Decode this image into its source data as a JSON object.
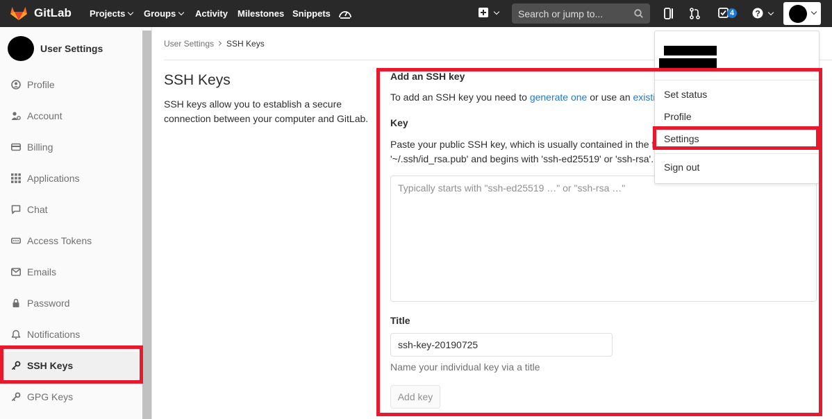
{
  "topbar": {
    "brand": "GitLab",
    "nav": [
      {
        "label": "Projects",
        "dropdown": true
      },
      {
        "label": "Groups",
        "dropdown": true
      },
      {
        "label": "Activity",
        "dropdown": false
      },
      {
        "label": "Milestones",
        "dropdown": false
      },
      {
        "label": "Snippets",
        "dropdown": false
      }
    ],
    "search_placeholder": "Search or jump to...",
    "todos_count": "4",
    "icons": [
      "gitlab-logo-icon",
      "dashboard-gauge-icon",
      "plus-icon",
      "search-icon",
      "sidebar-toggle-icon",
      "merge-request-icon",
      "todo-check-icon",
      "help-icon",
      "avatar"
    ],
    "accent": "#1f78d1"
  },
  "sidebar": {
    "title": "User Settings",
    "items": [
      {
        "label": "Profile",
        "icon": "profile-icon",
        "active": false
      },
      {
        "label": "Account",
        "icon": "account-icon",
        "active": false
      },
      {
        "label": "Billing",
        "icon": "credit-card-icon",
        "active": false
      },
      {
        "label": "Applications",
        "icon": "applications-grid-icon",
        "active": false
      },
      {
        "label": "Chat",
        "icon": "chat-bubble-icon",
        "active": false
      },
      {
        "label": "Access Tokens",
        "icon": "token-icon",
        "active": false
      },
      {
        "label": "Emails",
        "icon": "envelope-icon",
        "active": false
      },
      {
        "label": "Password",
        "icon": "lock-icon",
        "active": false
      },
      {
        "label": "Notifications",
        "icon": "bell-icon",
        "active": false
      },
      {
        "label": "SSH Keys",
        "icon": "key-icon",
        "active": true
      },
      {
        "label": "GPG Keys",
        "icon": "key-icon",
        "active": false
      }
    ]
  },
  "breadcrumb": {
    "parent": "User Settings",
    "current": "SSH Keys"
  },
  "page": {
    "title": "SSH Keys",
    "description": "SSH keys allow you to establish a secure connection between your computer and GitLab."
  },
  "form": {
    "section_title": "Add an SSH key",
    "intro_prefix": "To add an SSH key you need to",
    "intro_link1": "generate one",
    "intro_middle": "or use an",
    "intro_link2": "existin",
    "key_label": "Key",
    "key_help_line1": "Paste your public SSH key, which is usually contained in the fil",
    "key_help_line2": "'~/.ssh/id_rsa.pub' and begins with 'ssh-ed25519' or 'ssh-rsa'.",
    "key_placeholder": "Typically starts with \"ssh-ed25519 …\" or \"ssh-rsa …\"",
    "title_label": "Title",
    "title_value": "ssh-key-20190725",
    "title_help": "Name your individual key via a title",
    "add_button": "Add key"
  },
  "user_dropdown": {
    "items": [
      "Set status",
      "Profile",
      "Settings",
      "Sign out"
    ]
  },
  "annotation_color": "#e8192c"
}
